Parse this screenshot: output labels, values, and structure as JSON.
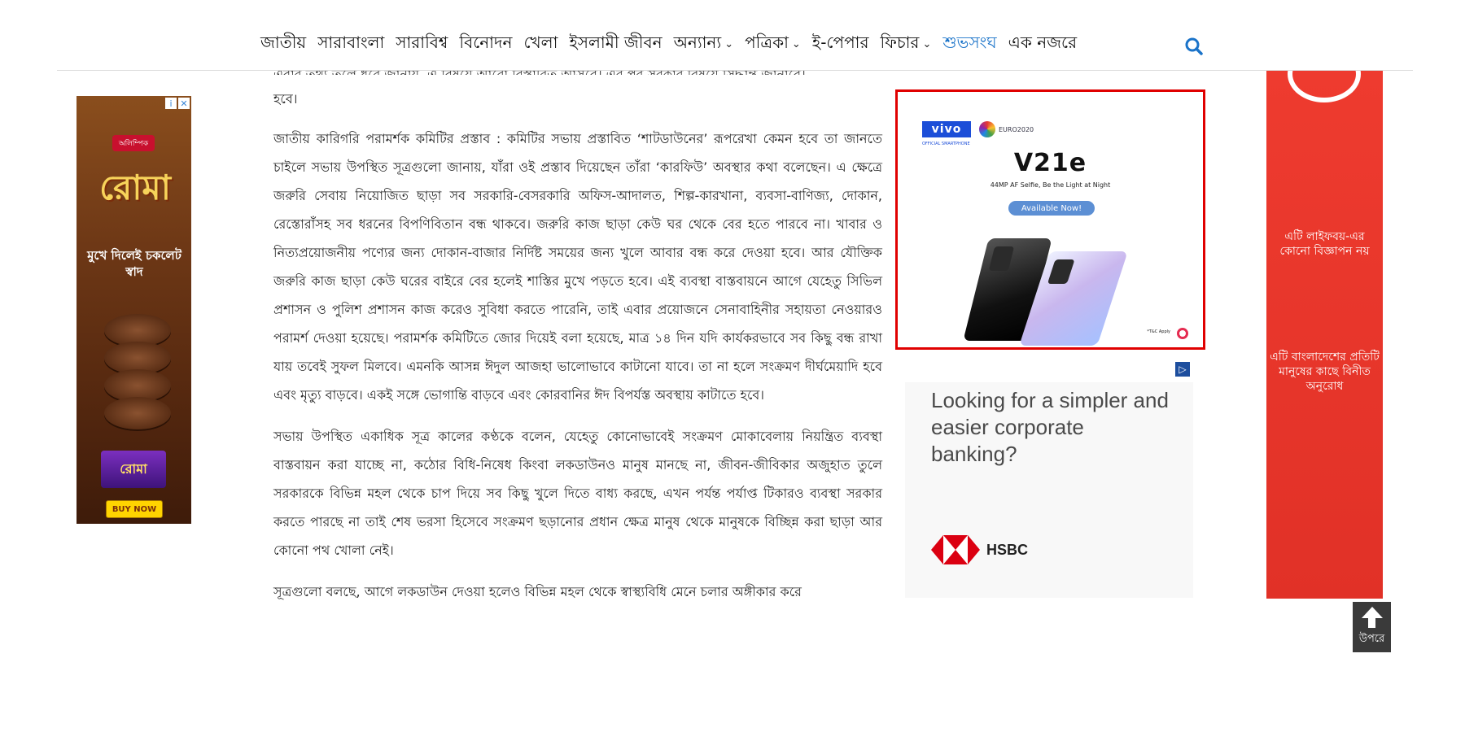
{
  "nav": {
    "items": [
      {
        "label": "জাতীয়",
        "dropdown": false,
        "highlight": false
      },
      {
        "label": "সারাবাংলা",
        "dropdown": false,
        "highlight": false
      },
      {
        "label": "সারাবিশ্ব",
        "dropdown": false,
        "highlight": false
      },
      {
        "label": "বিনোদন",
        "dropdown": false,
        "highlight": false
      },
      {
        "label": "খেলা",
        "dropdown": false,
        "highlight": false
      },
      {
        "label": "ইসলামী জীবন",
        "dropdown": false,
        "highlight": false
      },
      {
        "label": "অন্যান্য",
        "dropdown": true,
        "highlight": false
      },
      {
        "label": "পত্রিকা",
        "dropdown": true,
        "highlight": false
      },
      {
        "label": "ই-পেপার",
        "dropdown": false,
        "highlight": false
      },
      {
        "label": "ফিচার",
        "dropdown": true,
        "highlight": false
      },
      {
        "label": "শুভসংঘ",
        "dropdown": false,
        "highlight": true
      },
      {
        "label": "এক নজরে",
        "dropdown": false,
        "highlight": false
      }
    ],
    "search_icon": "search-icon",
    "highlight_color": "#1a73c9"
  },
  "article": {
    "cut_text": "এবার তথ্য তুলে ধরে জানায়, এ বিষয়ে আরো বিস্তারিত আসবে। এর পর সরকার বিষয়ে সিদ্ধান্ত জানাবে।",
    "paragraphs": [
      "হবে।",
      "জাতীয় কারিগরি পরামর্শক কমিটির প্রস্তাব : কমিটির সভায় প্রস্তাবিত ‘শাটডাউনের’ রূপরেখা কেমন হবে তা জানতে চাইলে সভায় উপস্থিত সূত্রগুলো জানায়, যাঁরা ওই প্রস্তাব দিয়েছেন তাঁরা ‘কারফিউ’ অবস্থার কথা বলেছেন। এ ক্ষেত্রে জরুরি সেবায় নিয়োজিত ছাড়া সব সরকারি-বেসরকারি অফিস-আদালত, শিল্প-কারখানা, ব্যবসা-বাণিজ্য, দোকান, রেস্তোরাঁসহ সব ধরনের বিপণিবিতান বন্ধ থাকবে। জরুরি কাজ ছাড়া কেউ ঘর থেকে বের হতে পারবে না। খাবার ও নিত্যপ্রয়োজনীয় পণ্যের জন্য দোকান-বাজার নির্দিষ্ট সময়ের জন্য খুলে আবার বন্ধ করে দেওয়া হবে। আর যৌক্তিক জরুরি কাজ ছাড়া কেউ ঘরের বাইরে বের হলেই শাস্তির মুখে পড়তে হবে। এই ব্যবস্থা বাস্তবায়নে আগে যেহেতু সিভিল প্রশাসন ও পুলিশ প্রশাসন কাজ করেও সুবিধা করতে পারেনি, তাই এবার প্রয়োজনে সেনাবাহিনীর সহায়তা নেওয়ারও পরামর্শ দেওয়া হয়েছে। পরামর্শক কমিটিতে জোর দিয়েই বলা হয়েছে, মাত্র ১৪ দিন যদি কার্যকরভাবে সব কিছু বন্ধ রাখা যায় তবেই সুফল মিলবে। এমনকি আসন্ন ঈদুল আজহা ভালোভাবে কাটানো যাবে। তা না হলে সংক্রমণ দীর্ঘমেয়াদি হবে এবং মৃত্যু বাড়বে। একই সঙ্গে ভোগান্তি বাড়বে এবং কোরবানির ঈদ বিপর্যস্ত অবস্থায় কাটাতে হবে।",
      "সভায় উপস্থিত একাধিক সূত্র কালের কণ্ঠকে বলেন, যেহেতু কোনোভাবেই সংক্রমণ মোকাবেলায় নিয়ন্ত্রিত ব্যবস্থা বাস্তবায়ন করা যাচ্ছে না, কঠোর বিধি-নিষেধ কিংবা লকডাউনও মানুষ মানছে না, জীবন-জীবিকার অজুহাত তুলে সরকারকে বিভিন্ন মহল থেকে চাপ দিয়ে সব কিছু খুলে দিতে বাধ্য করছে, এখন পর্যন্ত পর্যাপ্ত টিকারও ব্যবস্থা সরকার করতে পারছে না তাই শেষ ভরসা হিসেবে সংক্রমণ ছড়ানোর প্রধান ক্ষেত্র মানুষ থেকে মানুষকে বিচ্ছিন্ন করা ছাড়া আর কোনো পথ খোলা নেই।",
      "সূত্রগুলো বলছে, আগে লকডাউন দেওয়া হলেও বিভিন্ন মহল থেকে স্বাস্থ্যবিধি মেনে চলার অঙ্গীকার করে"
    ]
  },
  "left_ad": {
    "badge": "অলিম্পিক",
    "brand": "রোমা",
    "tagline": "মুখে দিলেই চকলেট স্বাদ",
    "pack_label": "রোমা",
    "cta": "BUY NOW",
    "info_icon": "info-icon",
    "close_icon": "close-icon"
  },
  "vivo_ad": {
    "brand": "vivo",
    "partner": "EURO2020",
    "official": "OFFICIAL SMARTPHONE",
    "model": "V21e",
    "tagline": "44MP AF Selfie, Be the Light at Night",
    "cta": "Available Now!",
    "tnc": "*T&C Apply",
    "border_color": "#e00000"
  },
  "hsbc_ad": {
    "headline": "Looking for a simpler and easier corporate banking?",
    "brand": "HSBC",
    "adchoices_icon": "adchoices-icon"
  },
  "right_banner": {
    "text1": "এটি লাইফবয়-এর কোনো বিজ্ঞাপন নয়",
    "text2": "এটি বাংলাদেশের প্রতিটি মানুষের কাছে বিনীত অনুরোধ",
    "color": "#e13127"
  },
  "back_to_top": {
    "label": "উপরে",
    "icon": "arrow-up-icon"
  }
}
